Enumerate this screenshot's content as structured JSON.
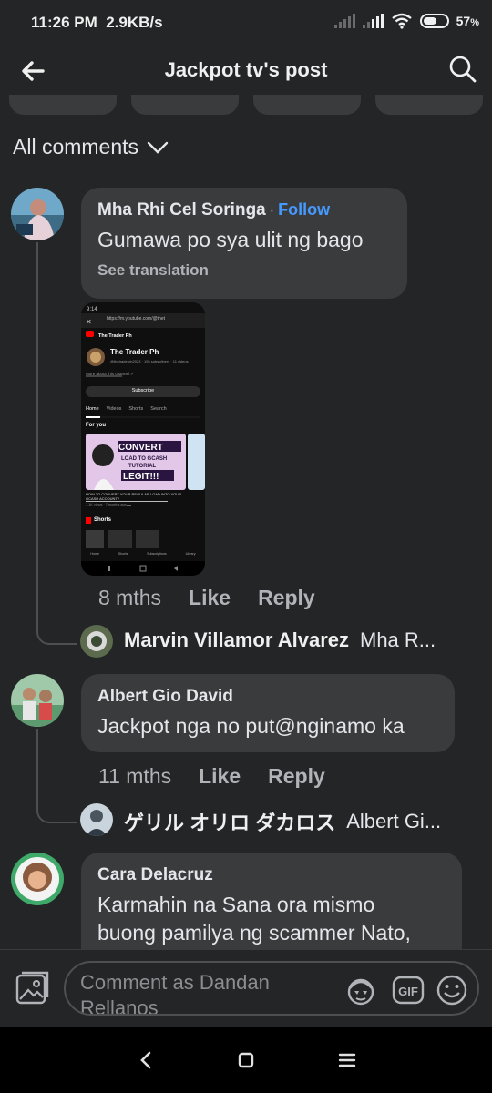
{
  "status": {
    "time": "11:26 PM",
    "net_speed": "2.9KB/s",
    "battery_pct": "57",
    "battery_sign": "%",
    "battery_level": 0.57
  },
  "header": {
    "title": "Jackpot tv's post"
  },
  "filter": {
    "label": "All comments"
  },
  "comments": [
    {
      "author": "Mha Rhi Cel Soringa",
      "separator": "·",
      "follow_label": "Follow",
      "text": "Gumawa po sya ulit ng bago",
      "see_translation": "See translation",
      "time": "8 mths",
      "like": "Like",
      "reply": "Reply",
      "reply_preview": {
        "name": "Marvin Villamor Alvarez",
        "snippet": "Mha R..."
      }
    },
    {
      "author": "Albert Gio David",
      "text": "Jackpot nga no put@nginamo ka",
      "time": "11 mths",
      "like": "Like",
      "reply": "Reply",
      "reply_preview": {
        "name": "ゲリル オリロ ダカロス",
        "snippet": "Albert Gi..."
      }
    },
    {
      "author": "Cara Delacruz",
      "text_line1": "Karmahin na Sana ora mismo",
      "text_line2": "buong pamilya ng scammer Nato,"
    }
  ],
  "attachment": {
    "url": "https://m.youtube.com/@thet",
    "channel_name": "The Trader Ph",
    "channel_meta": "@thetraderph2023 · 193 subscribers · 11 videos",
    "more_about": "More about this channel >",
    "subscribe": "Subscribe",
    "tabs": [
      "Home",
      "Videos",
      "Shorts",
      "Search"
    ],
    "for_you": "For you",
    "thumb_line1": "CONVERT",
    "thumb_line2": "LOAD TO GCASH",
    "thumb_line3": "TUTORIAL",
    "thumb_line4": "LEGIT!!!",
    "video_title": "HOW TO CONVERT YOUR REGULAR LOAD INTO YOUR GCASH ACCOUNT?",
    "video_meta": "7.1K views · 7 months ago",
    "shorts": "Shorts",
    "bottom_nav": [
      "Home",
      "Shorts",
      "Subscriptions",
      "Library"
    ]
  },
  "composer": {
    "placeholder": "Comment as Dandan Rellanos"
  },
  "colors": {
    "background": "#242526",
    "bubble": "#3a3b3c",
    "link": "#4599ff",
    "muted": "#b0b3b8"
  }
}
